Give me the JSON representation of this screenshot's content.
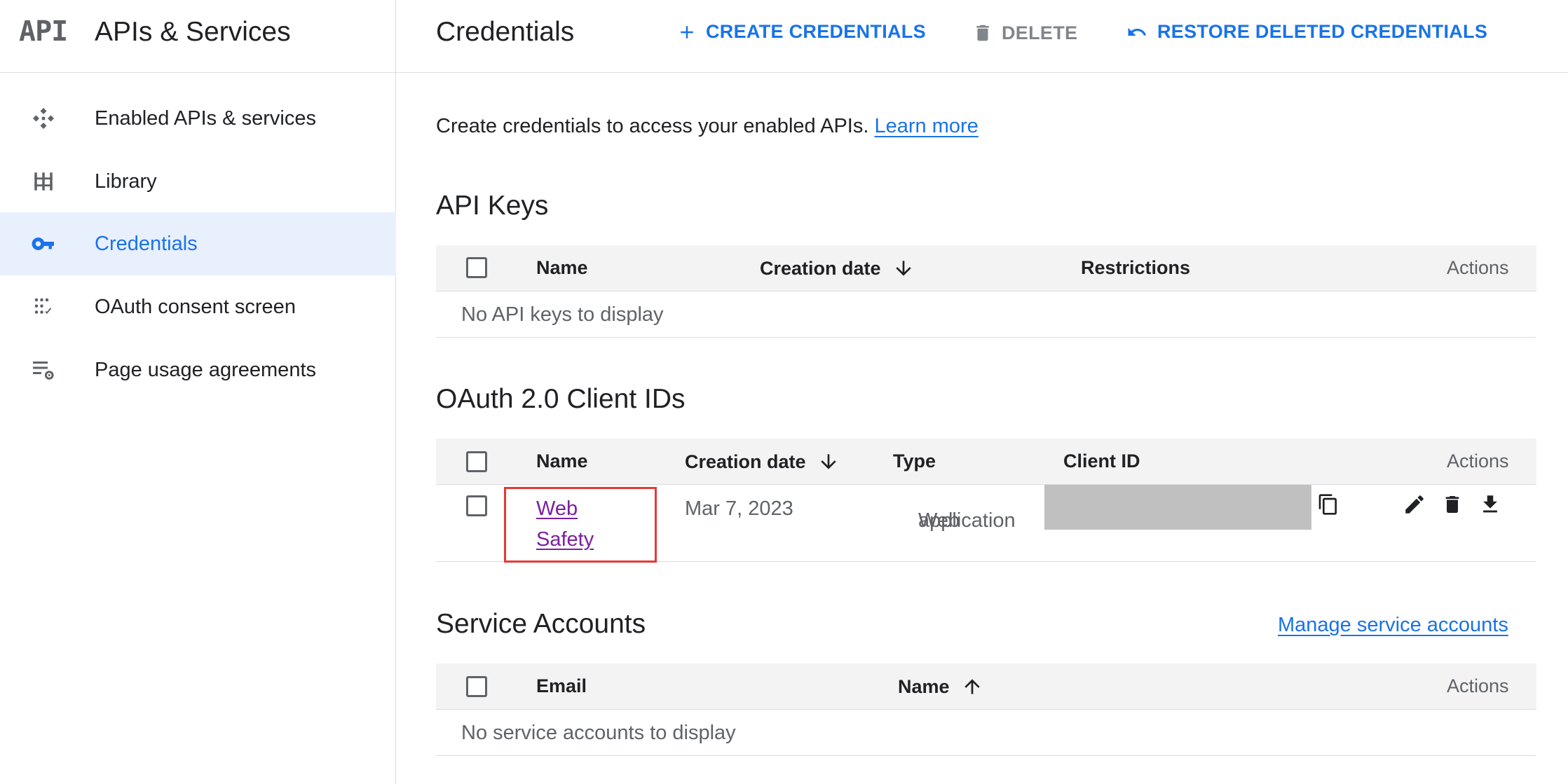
{
  "brand": {
    "logo_text": "API",
    "title": "APIs & Services"
  },
  "sidebar": {
    "items": [
      {
        "label": "Enabled APIs & services",
        "icon": "enabled-apis-icon",
        "active": false
      },
      {
        "label": "Library",
        "icon": "library-icon",
        "active": false
      },
      {
        "label": "Credentials",
        "icon": "key-icon",
        "active": true
      },
      {
        "label": "OAuth consent screen",
        "icon": "oauth-consent-icon",
        "active": false
      },
      {
        "label": "Page usage agreements",
        "icon": "page-settings-icon",
        "active": false
      }
    ]
  },
  "header": {
    "title": "Credentials",
    "create_label": "CREATE CREDENTIALS",
    "delete_label": "DELETE",
    "restore_label": "RESTORE DELETED CREDENTIALS"
  },
  "intro": {
    "text": "Create credentials to access your enabled APIs. ",
    "link": "Learn more"
  },
  "api_keys": {
    "title": "API Keys",
    "columns": {
      "name": "Name",
      "creation_date": "Creation date",
      "restrictions": "Restrictions",
      "actions": "Actions"
    },
    "empty_text": "No API keys to display"
  },
  "oauth": {
    "title": "OAuth 2.0 Client IDs",
    "columns": {
      "name": "Name",
      "creation_date": "Creation date",
      "type": "Type",
      "client_id": "Client ID",
      "actions": "Actions"
    },
    "rows": [
      {
        "name_line1": "Web",
        "name_line2": "Safety",
        "creation_date": "Mar 7, 2023",
        "type_line1": "Web",
        "type_line2": "application"
      }
    ]
  },
  "service_accounts": {
    "title": "Service Accounts",
    "manage_link": "Manage service accounts",
    "columns": {
      "email": "Email",
      "name": "Name",
      "actions": "Actions"
    },
    "empty_text": "No service accounts to display"
  },
  "colors": {
    "accent": "#1a73e8",
    "link_visited": "#7b1fa2",
    "highlight_box": "#e53935",
    "active_bg": "#e8f0fe"
  }
}
